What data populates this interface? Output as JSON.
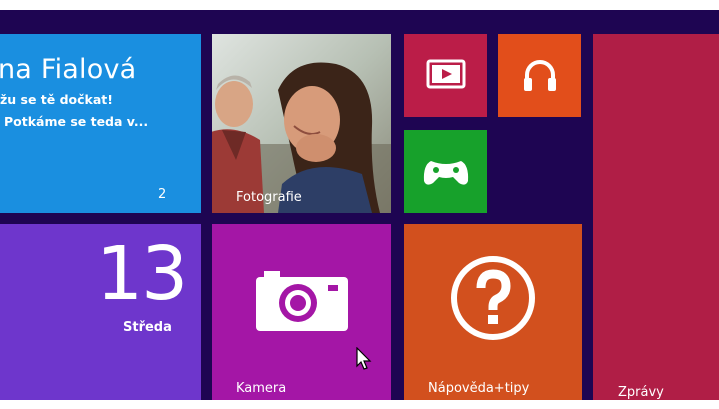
{
  "tiles": {
    "mail": {
      "sender": "na Fialová",
      "line1": "žu se tě dočkat!",
      "line2": "Potkáme se teda v...",
      "count": "2"
    },
    "photos": {
      "label": "Fotografie"
    },
    "calendar": {
      "day_number": "13",
      "day_name": "Středa"
    },
    "camera": {
      "label": "Kamera"
    },
    "tips": {
      "label": "Nápověda+tipy"
    },
    "news": {
      "label": "Zprávy"
    }
  },
  "icons": {
    "video": "video-play-icon",
    "music": "headphones-icon",
    "games": "game-controller-icon",
    "camera": "camera-icon",
    "tips": "question-mark-icon",
    "cursor": "mouse-pointer-icon"
  },
  "colors": {
    "background": "#1e0552",
    "mail": "#1a8fe0",
    "video": "#bb1d48",
    "music": "#e24e1b",
    "games": "#17a12b",
    "news": "#b01e46",
    "calendar": "#6e36cc",
    "camera": "#a416a6",
    "tips": "#d2501e"
  }
}
